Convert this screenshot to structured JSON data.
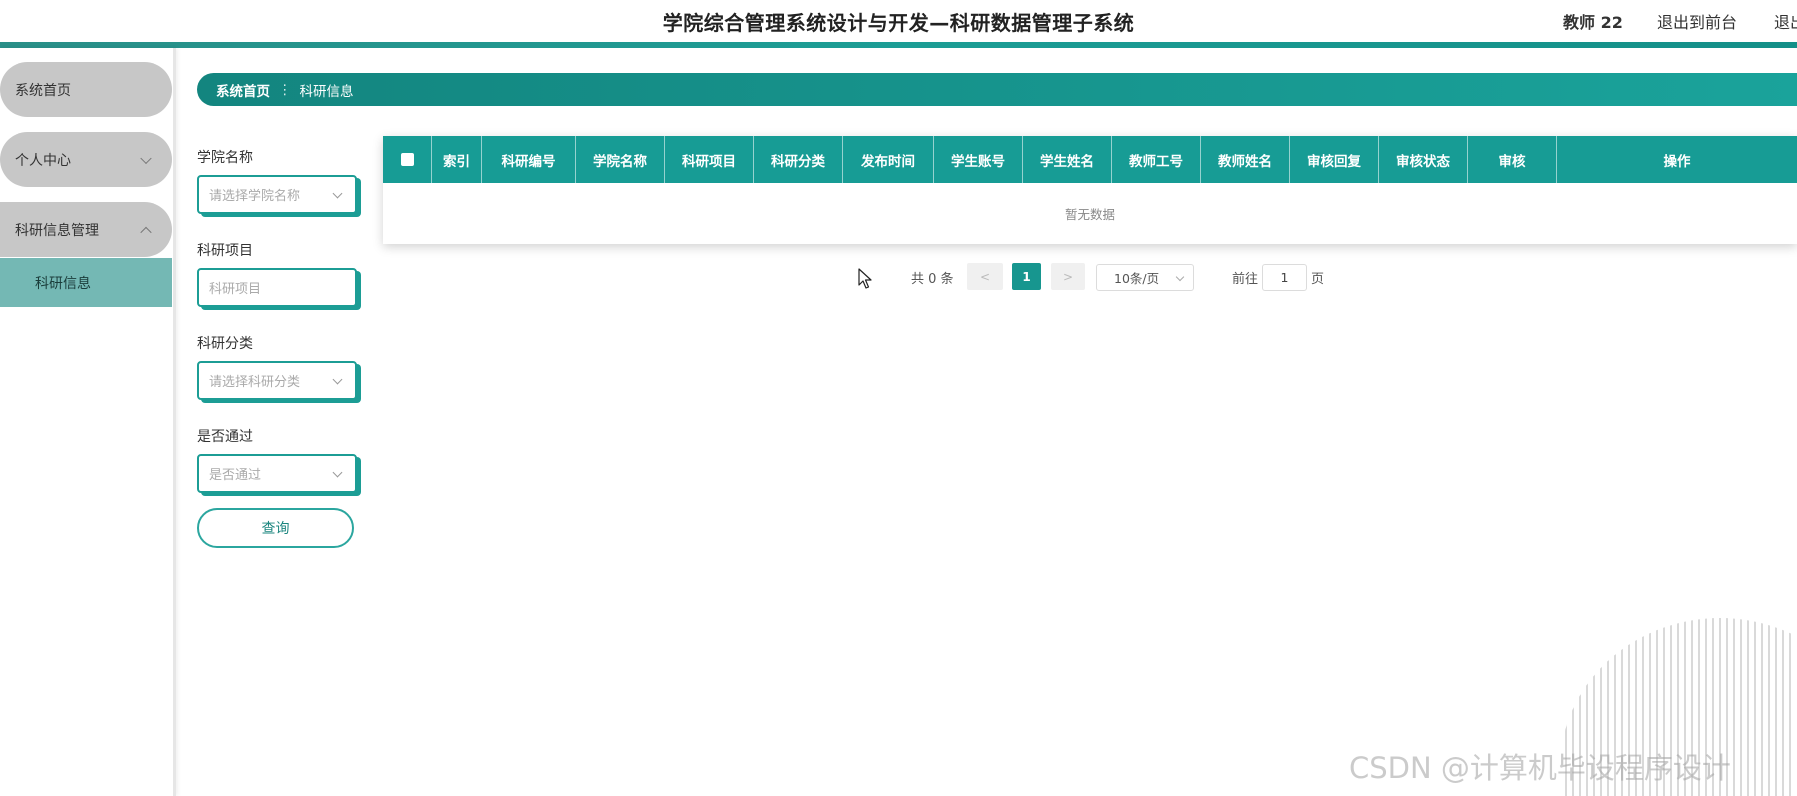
{
  "header": {
    "title": "学院综合管理系统设计与开发—科研数据管理子系统",
    "user": "教师 22",
    "back_to_front": "退出到前台",
    "logout": "退出"
  },
  "sidebar": {
    "items": [
      {
        "label": "系统首页"
      },
      {
        "label": "个人中心",
        "expanded": false
      },
      {
        "label": "科研信息管理",
        "expanded": true,
        "children": [
          {
            "label": "科研信息",
            "active": true
          }
        ]
      }
    ]
  },
  "breadcrumb": {
    "home": "系统首页",
    "separator": "⋮",
    "current": "科研信息"
  },
  "search_form": {
    "fields": [
      {
        "label": "学院名称",
        "placeholder": "请选择学院名称",
        "type": "select"
      },
      {
        "label": "科研项目",
        "placeholder": "科研项目",
        "type": "input"
      },
      {
        "label": "科研分类",
        "placeholder": "请选择科研分类",
        "type": "select"
      },
      {
        "label": "是否通过",
        "placeholder": "是否通过",
        "type": "select"
      }
    ],
    "query_button": "查询"
  },
  "table": {
    "columns": [
      "索引",
      "科研编号",
      "学院名称",
      "科研项目",
      "科研分类",
      "发布时间",
      "学生账号",
      "学生姓名",
      "教师工号",
      "教师姓名",
      "审核回复",
      "审核状态",
      "审核",
      "操作"
    ],
    "rows": [],
    "empty_text": "暂无数据"
  },
  "pagination": {
    "total_text": "共 0 条",
    "prev": "<",
    "current_page": "1",
    "next": ">",
    "page_size": "10条/页",
    "goto_label": "前往",
    "goto_value": "1",
    "page_suffix": "页"
  },
  "watermark": "CSDN @计算机毕设程序设计",
  "colors": {
    "primary": "#179c95",
    "primary_dark": "#13857f",
    "sidebar_pill": "#c7c7c7",
    "sidebar_active": "#74b8b4"
  }
}
